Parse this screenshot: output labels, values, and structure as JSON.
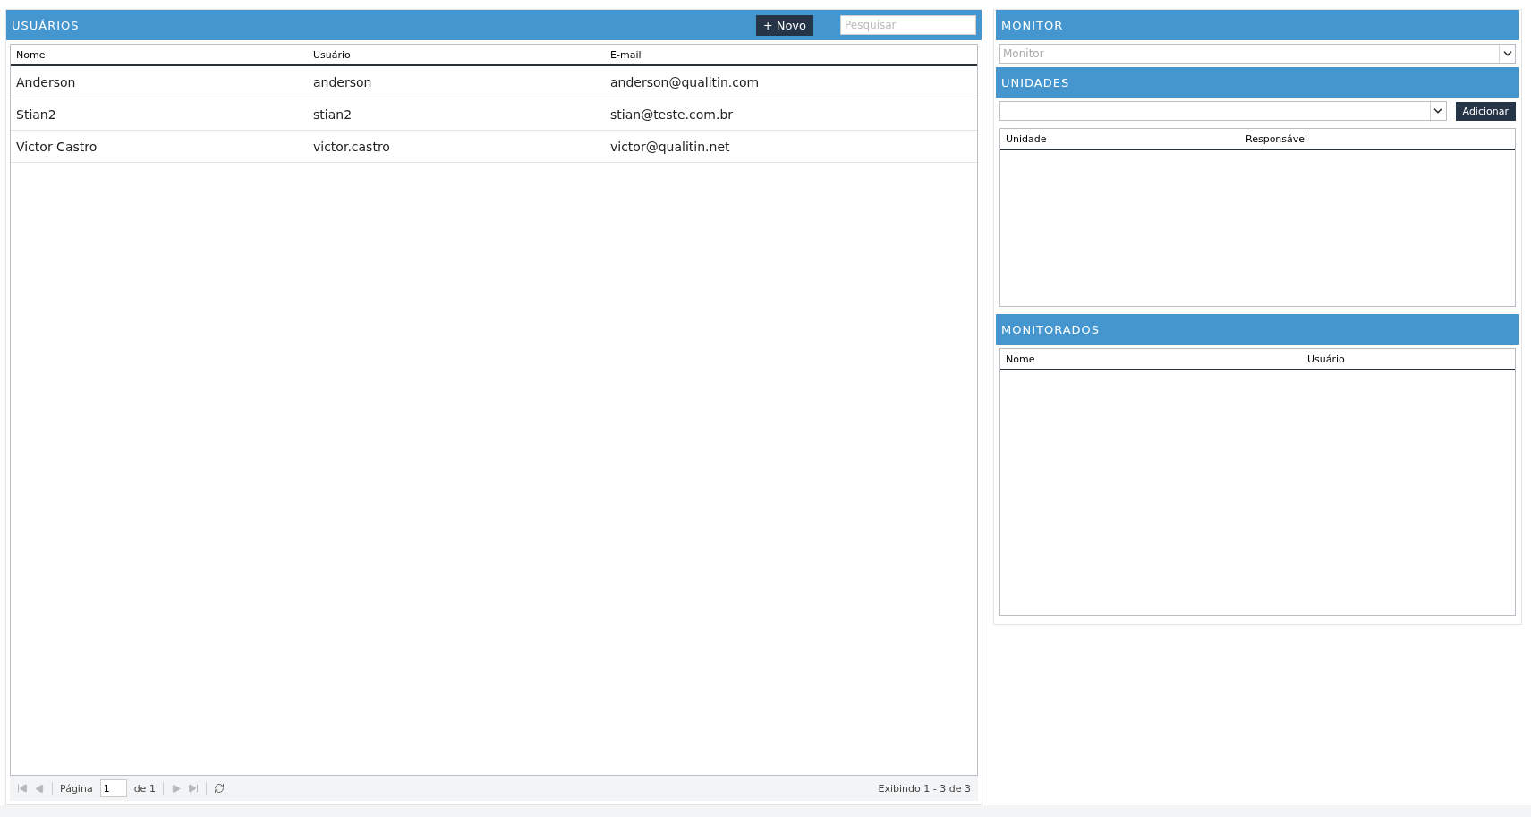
{
  "usuarios": {
    "title": "USUÁRIOS",
    "new_button": "+ Novo",
    "search": {
      "placeholder": "Pesquisar"
    },
    "columns": [
      "Nome",
      "Usuário",
      "E-mail"
    ],
    "rows": [
      [
        "Anderson",
        "anderson",
        "anderson@qualitin.com"
      ],
      [
        "Stian2",
        "stian2",
        "stian@teste.com.br"
      ],
      [
        "Victor Castro",
        "victor.castro",
        "victor@qualitin.net"
      ]
    ],
    "pager": {
      "page_label": "Página",
      "page": "1",
      "of": "de 1",
      "summary": "Exibindo 1 - 3 de 3"
    }
  },
  "monitor": {
    "title": "MONITOR",
    "select": {
      "placeholder": "Monitor"
    }
  },
  "unidades": {
    "title": "UNIDADES",
    "add_button": "Adicionar",
    "columns": [
      "Unidade",
      "Responsável"
    ]
  },
  "monitorados": {
    "title": "MONITORADOS",
    "columns": [
      "Nome",
      "Usuário"
    ]
  }
}
